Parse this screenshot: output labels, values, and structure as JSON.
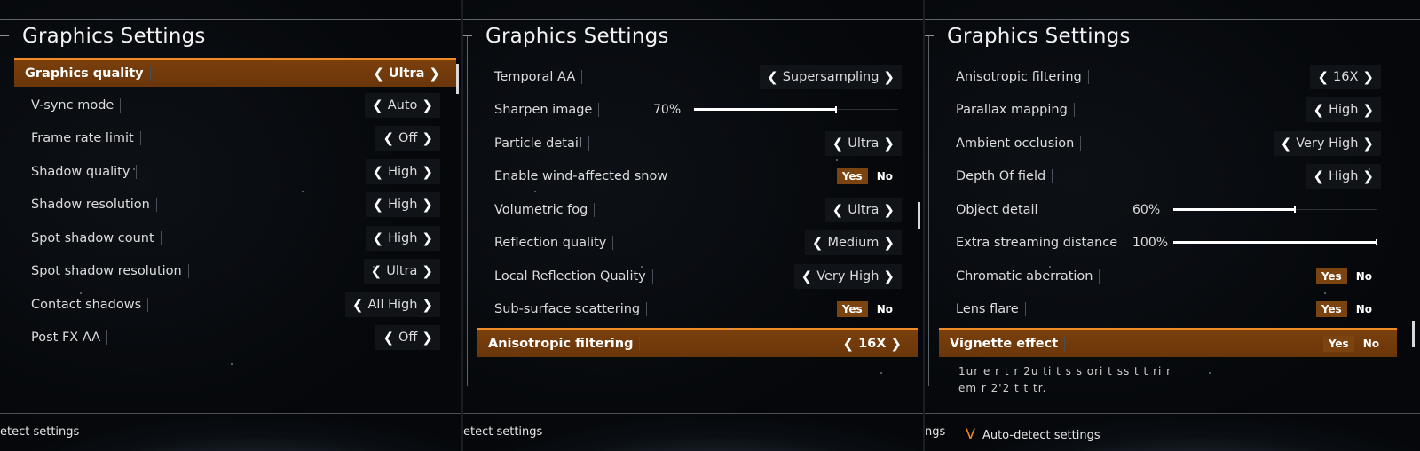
{
  "colors": {
    "accent": "#f08a24",
    "highlight_row": "#7a3f0c",
    "yes_bg": "#7a430f",
    "background": "#06080b"
  },
  "panel1": {
    "title": "Graphics Settings",
    "items": [
      {
        "label": "Graphics quality",
        "value": "Ultra",
        "highlighted": true
      },
      {
        "label": "V-sync mode",
        "value": "Auto"
      },
      {
        "label": "Frame rate limit",
        "value": "Off"
      },
      {
        "label": "Shadow quality",
        "value": "High"
      },
      {
        "label": "Shadow resolution",
        "value": "High"
      },
      {
        "label": "Spot shadow count",
        "value": "High"
      },
      {
        "label": "Spot shadow resolution",
        "value": "Ultra"
      },
      {
        "label": "Contact shadows",
        "value": "All High"
      },
      {
        "label": "Post FX AA",
        "value": "Off"
      }
    ],
    "bottom": "etect settings"
  },
  "panel2": {
    "title": "Graphics Settings",
    "items": [
      {
        "label": "Temporal AA",
        "value": "Supersampling"
      },
      {
        "label": "Sharpen image",
        "percent": "70%",
        "level": 0.7
      },
      {
        "label": "Particle detail",
        "value": "Ultra"
      },
      {
        "label": "Enable wind-affected snow",
        "yes": "Yes",
        "no": "No"
      },
      {
        "label": "Volumetric fog",
        "value": "Ultra"
      },
      {
        "label": "Reflection quality",
        "value": "Medium"
      },
      {
        "label": "Local Reflection Quality",
        "value": "Very High"
      },
      {
        "label": "Sub-surface scattering",
        "yes": "Yes",
        "no": "No"
      },
      {
        "label": "Anisotropic filtering",
        "value": "16X",
        "highlighted": true
      }
    ],
    "bottom": "etect settings"
  },
  "panel3": {
    "title": "Graphics Settings",
    "items": [
      {
        "label": "Anisotropic filtering",
        "value": "16X"
      },
      {
        "label": "Parallax mapping",
        "value": "High"
      },
      {
        "label": "Ambient occlusion",
        "value": "Very High"
      },
      {
        "label": "Depth Of field",
        "value": "High"
      },
      {
        "label": "Object detail",
        "percent": "60%",
        "level": 0.6
      },
      {
        "label": "Extra streaming distance",
        "percent": "100%",
        "level": 1.0
      },
      {
        "label": "Chromatic aberration",
        "yes": "Yes",
        "no": "No"
      },
      {
        "label": "Lens flare",
        "yes": "Yes",
        "no": "No"
      },
      {
        "label": "Vignette effect",
        "yes": "Yes",
        "no": "No",
        "highlighted": true
      }
    ],
    "description_line1": "1ur  e  r   t  r  2u ti     t  s   s ori t   ss  t t    ri  r",
    "description_line2": "em r  2'2 t  t     tr.",
    "bottom_prefix": "ngs",
    "auto_detect_icon": "V",
    "auto_detect_label": "Auto-detect settings"
  }
}
